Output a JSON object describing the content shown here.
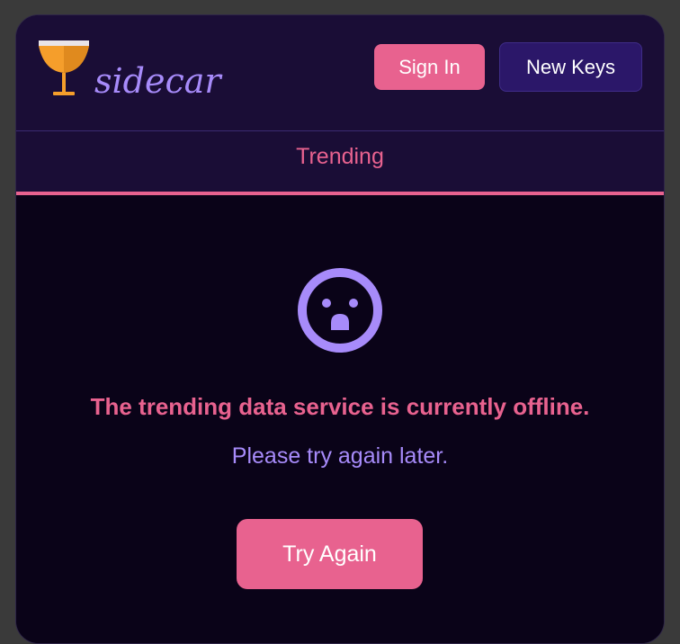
{
  "header": {
    "logo_text": "sidecar",
    "sign_in_label": "Sign In",
    "new_keys_label": "New Keys"
  },
  "tabs": [
    {
      "label": "Trending",
      "active": true
    }
  ],
  "error": {
    "icon": "shocked-face-icon",
    "title": "The trending data service is currently offline.",
    "subtitle": "Please try again later.",
    "retry_label": "Try Again"
  },
  "colors": {
    "accent_pink": "#e8628f",
    "accent_purple": "#a78bfa",
    "header_bg": "#1a0d36",
    "content_bg": "#0a0318",
    "new_keys_bg": "#2b1769",
    "logo_glass": "#f59e2b"
  }
}
